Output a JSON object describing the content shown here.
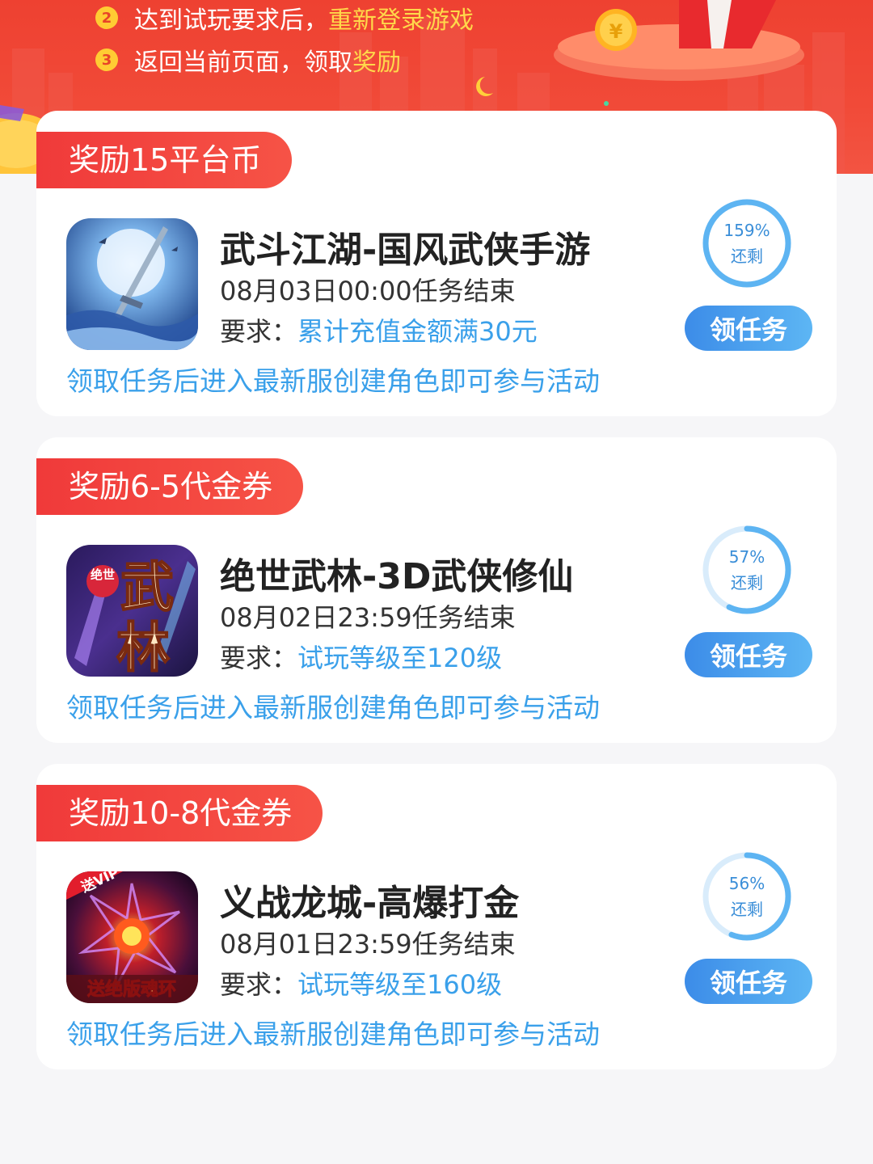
{
  "colors": {
    "banner_red": "#ee4131",
    "tag_red": "#f03a3a",
    "accent_blue": "#3aa0ea",
    "button_blue": "#3c8ce8",
    "highlight_yellow": "#ffd84a"
  },
  "banner": {
    "steps": [
      {
        "num": "2",
        "text": "达到试玩要求后，",
        "highlight": "重新登录游戏"
      },
      {
        "num": "3",
        "text": "返回当前页面，领取",
        "highlight": "奖励"
      }
    ]
  },
  "tasks": [
    {
      "reward": "奖励15平台币",
      "icon": "sword-moon-game-icon",
      "title": "武斗江湖-国风武侠手游",
      "deadline": "08月03日00:00任务结束",
      "req_label": "要求：",
      "req_value": "累计充值金额满30元",
      "hint": "领取任务后进入最新服创建角色即可参与活动",
      "remaining_pct_text": "159%",
      "remaining_fraction": 1.0,
      "remaining_label": "还剩",
      "button": "领任务"
    },
    {
      "reward": "奖励6-5代金券",
      "icon": "wulin-game-icon",
      "title": "绝世武林-3D武侠修仙",
      "deadline": "08月02日23:59任务结束",
      "req_label": "要求：",
      "req_value": "试玩等级至120级",
      "hint": "领取任务后进入最新服创建角色即可参与活动",
      "remaining_pct_text": "57%",
      "remaining_fraction": 0.57,
      "remaining_label": "还剩",
      "button": "领任务",
      "icon_text": [
        "绝世",
        "武",
        "林"
      ]
    },
    {
      "reward": "奖励10-8代金券",
      "icon": "dragon-city-game-icon",
      "title": "义战龙城-高爆打金",
      "deadline": "08月01日23:59任务结束",
      "req_label": "要求：",
      "req_value": "试玩等级至160级",
      "hint": "领取任务后进入最新服创建角色即可参与活动",
      "remaining_pct_text": "56%",
      "remaining_fraction": 0.56,
      "remaining_label": "还剩",
      "button": "领任务",
      "icon_text": [
        "送VIP",
        "送绝版魂环"
      ]
    }
  ]
}
